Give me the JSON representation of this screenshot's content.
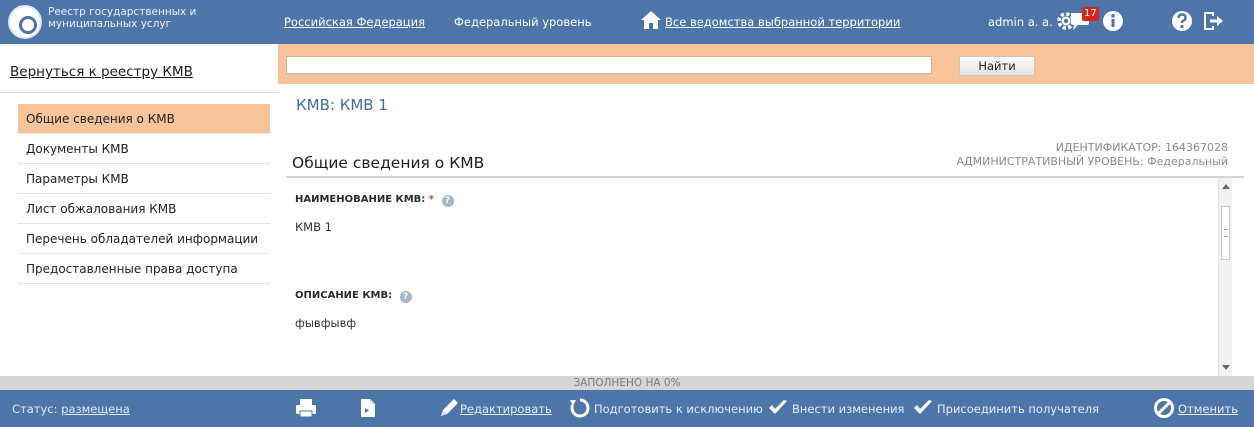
{
  "header": {
    "brand": "Реестр государственных и муниципальных услуг",
    "region": "Российская Федерация",
    "level": "Федеральный уровень",
    "departments": "Все ведомства выбранной территории",
    "user": "admin a. a.",
    "notification_count": "17",
    "icons": [
      "home-icon",
      "settings-icon",
      "messages-icon",
      "info-icon",
      "help-icon",
      "logout-icon"
    ]
  },
  "sidebar": {
    "back_label": "Вернуться к реестру КМВ",
    "items": [
      {
        "label": "Общие сведения о КМВ",
        "active": true
      },
      {
        "label": "Документы КМВ",
        "active": false
      },
      {
        "label": "Параметры КМВ",
        "active": false
      },
      {
        "label": "Лист обжалования КМВ",
        "active": false
      },
      {
        "label": "Перечень обладателей информации",
        "active": false
      },
      {
        "label": "Предоставленные права доступа",
        "active": false
      }
    ]
  },
  "search": {
    "value": "",
    "button_label": "Найти"
  },
  "main": {
    "title": "КМВ: КМВ 1",
    "section_title": "Общие сведения о КМВ",
    "id_label": "ИДЕНТИФИКАТОР: 164367028",
    "level_label": "АДМИНИСТРАТИВНЫЙ УРОВЕНЬ: Федеральный",
    "fields": [
      {
        "label": "НАИМЕНОВАНИЕ КМВ:",
        "required": "*",
        "value": "КМВ 1"
      },
      {
        "label": "ОПИСАНИЕ КМВ:",
        "required": "",
        "value": "фывфывф"
      }
    ]
  },
  "progress": {
    "label": "ЗАПОЛНЕНО НА 0%",
    "percent": 0
  },
  "footer": {
    "status_prefix": "Статус:",
    "status_value": "размещена",
    "actions": {
      "edit": "Редактировать",
      "prepare": "Подготовить к исключению",
      "apply": "Внести изменения",
      "attach": "Присоединить получателя",
      "cancel": "Отменить"
    }
  },
  "colors": {
    "header_bg": "#4d75aa",
    "accent_orange": "#f6c39a",
    "active_item": "#f7c39b",
    "title_blue": "#3f6ea6",
    "badge_red": "#d9261c"
  }
}
